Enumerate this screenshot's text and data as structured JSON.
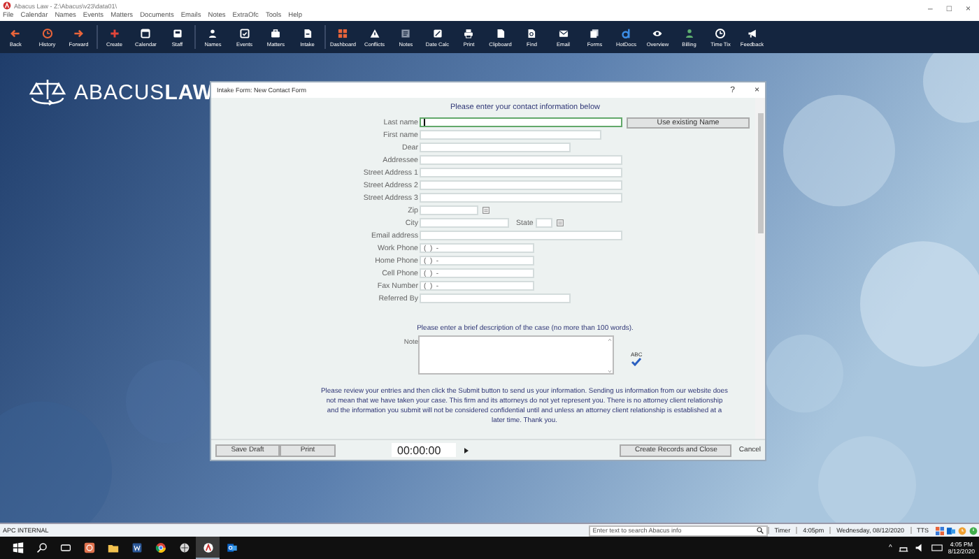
{
  "window": {
    "title": "Abacus Law - Z:\\Abacus\\v23\\data01\\",
    "controls": [
      "–",
      "□",
      "×"
    ]
  },
  "menu": [
    "File",
    "Calendar",
    "Names",
    "Events",
    "Matters",
    "Documents",
    "Emails",
    "Notes",
    "ExtraOfc",
    "Tools",
    "Help"
  ],
  "toolbar": [
    {
      "items": [
        "Back",
        "History",
        "Forward"
      ]
    },
    {
      "items": [
        "Create",
        "Calendar",
        "Staff"
      ]
    },
    {
      "items": [
        "Names",
        "Events",
        "Matters",
        "Intake"
      ]
    },
    {
      "items": [
        "Dashboard",
        "Conflicts",
        "Notes",
        "Date Calc",
        "Print",
        "Clipboard",
        "Find",
        "Email",
        "Forms",
        "HotDocs",
        "Overview",
        "Billing",
        "Time Tix",
        "Feedback"
      ]
    }
  ],
  "logo": {
    "text": "ABACUS**LAW**"
  },
  "dialog": {
    "title": "Intake Form: New Contact Form",
    "help": "?",
    "close": "×",
    "heading": "Please enter your contact  information below",
    "fields": [
      {
        "label": "Last name",
        "kind": "text",
        "focused": true,
        "button": "Use existing Name"
      },
      {
        "label": "First name",
        "kind": "text",
        "focused": false
      },
      {
        "label": "Dear",
        "kind": "text",
        "focused": false
      },
      {
        "label": "Addressee",
        "kind": "text",
        "focused": false
      },
      {
        "label": "Street Address 1",
        "kind": "text",
        "focused": false
      },
      {
        "label": "Street Address 2",
        "kind": "text",
        "focused": false
      },
      {
        "label": "Street Address 3",
        "kind": "text",
        "focused": false
      },
      {
        "label": "Zip",
        "kind": "picker",
        "focused": false
      },
      {
        "label": "City",
        "kind": "city_state",
        "focused": false,
        "second_label": "State"
      },
      {
        "label": "Email address",
        "kind": "text",
        "focused": false
      },
      {
        "label": "Work Phone",
        "kind": "text",
        "focused": false,
        "value": "(  )  -"
      },
      {
        "label": "Home Phone",
        "kind": "text",
        "focused": false,
        "value": "(  )  -"
      },
      {
        "label": "Cell Phone",
        "kind": "text",
        "focused": false,
        "value": "(  )  -"
      },
      {
        "label": "Fax Number",
        "kind": "text",
        "focused": false,
        "value": "(  )  -"
      },
      {
        "label": "Referred By",
        "kind": "text",
        "focused": false
      }
    ],
    "note_prompt": "Please enter a brief description of the case (no more than 100 words).",
    "note_label": "Note",
    "spellcheck": "ABC",
    "disclaimer": "Please review your entries and then click the Submit button to send us your information. Sending us information from our website does not mean that we have taken your case. This firm and its attorneys do not yet represent you. There is no attorney client relationship and the information you submit will not be considered confidential until and unless an attorney client relationship is established at a later time. Thank you.",
    "footer": {
      "save_draft": "Save Draft",
      "print": "Print",
      "timer": "00:00:00",
      "create": "Create Records and Close",
      "cancel": "Cancel"
    }
  },
  "status_bar": {
    "left": "APC INTERNAL",
    "search_placeholder": "Enter text to search Abacus info",
    "timer": "Timer",
    "time": "4:05pm",
    "date": "Wednesday, 08/12/2020",
    "tts": "TTS"
  },
  "taskbar": {
    "apps": [
      {
        "active": false
      },
      {
        "active": false
      },
      {
        "active": false
      },
      {
        "active": false
      },
      {
        "active": false
      },
      {
        "active": true
      },
      {
        "active": false
      }
    ],
    "chevron": "^",
    "time": "4:05 PM",
    "date": "8/12/2020"
  }
}
